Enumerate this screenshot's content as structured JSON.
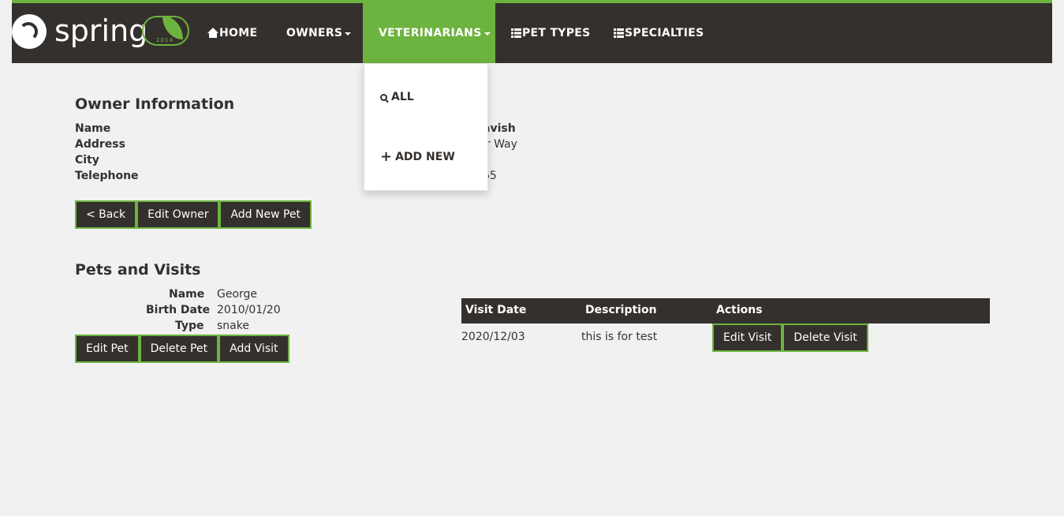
{
  "brand": {
    "wordmark": "spring",
    "badge_year": "2014"
  },
  "nav": {
    "home": "HOME",
    "owners": "OWNERS",
    "veterinarians": "VETERINARIANS",
    "pet_types": "PET TYPES",
    "specialties": "SPECIALTIES"
  },
  "dropdown": {
    "all": "ALL",
    "add_new": "ADD NEW"
  },
  "owner": {
    "heading": "Owner Information",
    "labels": {
      "name": "Name",
      "address": "Address",
      "city": "City",
      "telephone": "Telephone"
    },
    "values": {
      "name": "avish",
      "address": "ir Way",
      "city": "",
      "telephone": "65"
    },
    "buttons": {
      "back": "< Back",
      "edit": "Edit Owner",
      "add_pet": "Add New Pet"
    }
  },
  "pets": {
    "heading": "Pets and Visits",
    "labels": {
      "name": "Name",
      "birth_date": "Birth Date",
      "type": "Type"
    },
    "values": {
      "name": "George",
      "birth_date": "2010/01/20",
      "type": "snake"
    },
    "buttons": {
      "edit": "Edit Pet",
      "delete": "Delete Pet",
      "add_visit": "Add Visit"
    }
  },
  "visits": {
    "headers": {
      "date": "Visit Date",
      "description": "Description",
      "actions": "Actions"
    },
    "rows": [
      {
        "date": "2020/12/03",
        "description": "this is for test",
        "edit": "Edit Visit",
        "delete": "Delete Visit"
      }
    ]
  },
  "colors": {
    "accent": "#6db33f",
    "dark": "#34302d",
    "background": "#f1f1f1"
  }
}
